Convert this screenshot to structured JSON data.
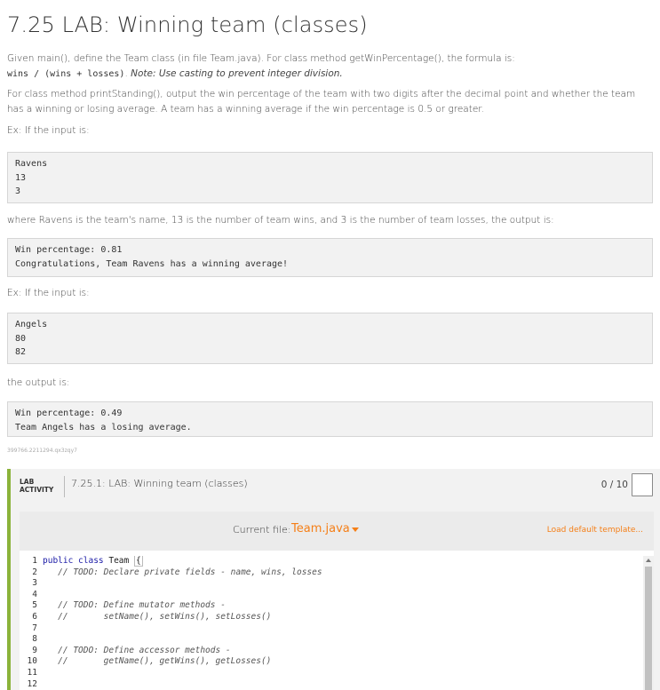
{
  "page_title": "7.25 LAB: Winning team (classes)",
  "intro": {
    "line1": "Given main(), define the Team class (in file Team.java). For class method getWinPercentage(), the formula is:",
    "formula": "wins / (wins + losses)",
    "note": "Note: Use casting to prevent integer division.",
    "para2": "For class method printStanding(), output the win percentage of the team with two digits after the decimal point and whether the team has a winning or losing average. A team has a winning average if the win percentage is 0.5 or greater.",
    "ex1_label": "Ex: If the input is:"
  },
  "example1": {
    "input": [
      "Ravens",
      "13",
      "3"
    ],
    "explain": "where Ravens is the team's name, 13 is the number of team wins, and 3 is the number of team losses, the output is:",
    "output": [
      "Win percentage: 0.81",
      "Congratulations, Team Ravens has a winning average!"
    ]
  },
  "example2": {
    "label": "Ex: If the input is:",
    "input": [
      "Angels",
      "80",
      "82"
    ],
    "output_label": "the output is:",
    "output": [
      "Win percentage: 0.49",
      "Team Angels has a losing average."
    ]
  },
  "hash": "399766.2211294.qx3zqy7",
  "activity": {
    "tag_line1": "LAB",
    "tag_line2": "ACTIVITY",
    "title": "7.25.1: LAB: Winning team (classes)",
    "score": "0 / 10",
    "current_file_label": "Current file:",
    "current_file": "Team.java",
    "load_default": "Load default template..."
  },
  "code_lines": [
    {
      "n": "1",
      "text": "public class Team {"
    },
    {
      "n": "2",
      "text": "   // TODO: Declare private fields - name, wins, losses"
    },
    {
      "n": "3",
      "text": ""
    },
    {
      "n": "4",
      "text": ""
    },
    {
      "n": "5",
      "text": "   // TODO: Define mutator methods -"
    },
    {
      "n": "6",
      "text": "   //       setName(), setWins(), setLosses()"
    },
    {
      "n": "7",
      "text": ""
    },
    {
      "n": "8",
      "text": ""
    },
    {
      "n": "9",
      "text": "   // TODO: Define accessor methods -"
    },
    {
      "n": "10",
      "text": "   //       getName(), getWins(), getLosses()"
    },
    {
      "n": "11",
      "text": ""
    },
    {
      "n": "12",
      "text": ""
    }
  ],
  "colors": {
    "accent": "#f57f17",
    "activity_border": "#8bb33a"
  }
}
